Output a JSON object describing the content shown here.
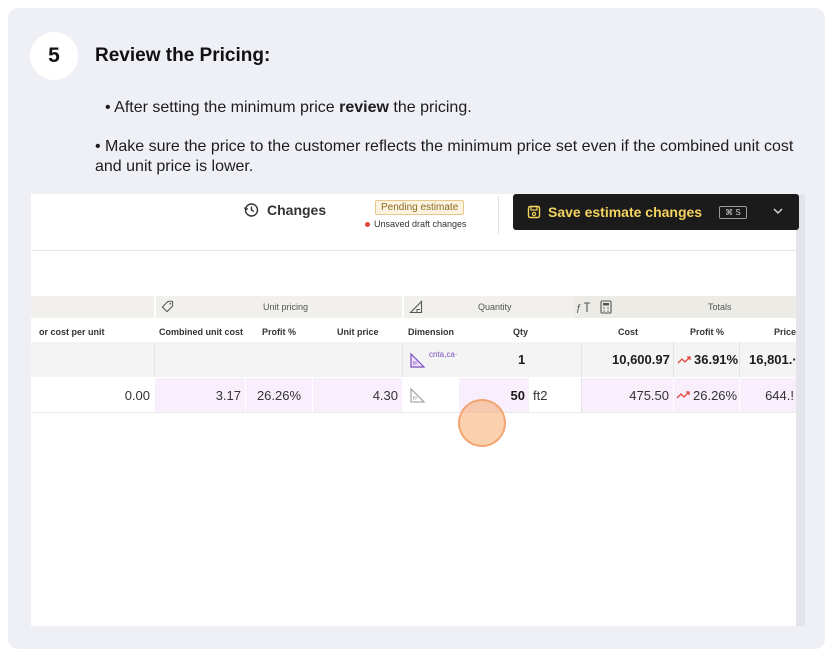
{
  "step": {
    "number": "5",
    "title": "Review the Pricing:",
    "bullet1_pre": "• After setting the minimum price ",
    "bullet1_bold": "review",
    "bullet1_post": " the pricing.",
    "bullet2": "• Make sure the price to the customer reflects the minimum price set even if the combined unit cost and unit price is lower."
  },
  "toolbar": {
    "changes_label": "Changes",
    "pending_badge": "Pending estimate",
    "unsaved_text": "Unsaved draft changes",
    "save_label": "Save estimate changes",
    "save_shortcut": "⌘ S"
  },
  "table": {
    "groups": {
      "unit_pricing": "Unit pricing",
      "quantity": "Quantity",
      "totals": "Totals"
    },
    "columns": {
      "labor_cost": "or cost per unit",
      "combined_unit_cost": "Combined unit cost",
      "profit_pct": "Profit %",
      "unit_price": "Unit price",
      "dimension": "Dimension",
      "qty": "Qty",
      "cost": "Cost",
      "totals_profit_pct": "Profit %",
      "price": "Price"
    },
    "summary_row": {
      "dimension": "cnta,ca·",
      "qty": "1",
      "cost": "10,600.97",
      "profit_pct": "36.91%",
      "price": "16,801.·"
    },
    "item_row": {
      "labor_cost": "0.00",
      "combined_unit_cost": "3.17",
      "profit_pct": "26.26%",
      "unit_price": "4.30",
      "qty": "50",
      "unit": "ft2",
      "cost": "475.50",
      "totals_profit_pct": "26.26%",
      "price": "644.!"
    }
  },
  "colors": {
    "save_button_bg": "#1b1b1b",
    "save_button_text": "#f4d35e",
    "row_highlight": "#f8eefc",
    "trend_icon": "#e0473b"
  }
}
